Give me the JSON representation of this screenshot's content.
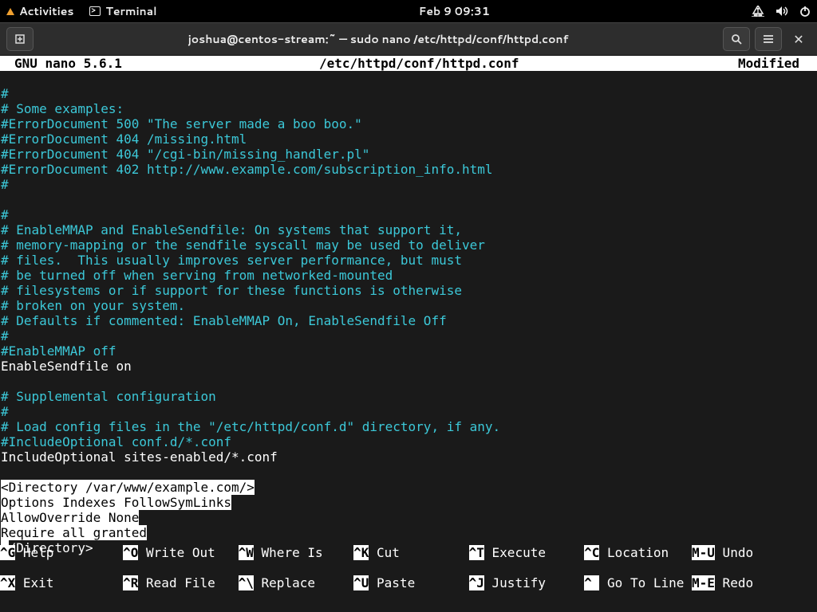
{
  "topbar": {
    "activities": "Activities",
    "terminal": "Terminal",
    "datetime": "Feb 9  09:31"
  },
  "titlebar": {
    "title": "joshua@centos-stream:~ — sudo nano /etc/httpd/conf/httpd.conf"
  },
  "statusbar": {
    "app": "GNU nano 5.6.1",
    "file": "/etc/httpd/conf/httpd.conf",
    "state": "Modified"
  },
  "lines": {
    "l1": "#",
    "l2": "# Some examples:",
    "l3": "#ErrorDocument 500 \"The server made a boo boo.\"",
    "l4": "#ErrorDocument 404 /missing.html",
    "l5": "#ErrorDocument 404 \"/cgi-bin/missing_handler.pl\"",
    "l6": "#ErrorDocument 402 http://www.example.com/subscription_info.html",
    "l7": "#",
    "l8_blank": "",
    "l9": "#",
    "l10": "# EnableMMAP and EnableSendfile: On systems that support it,",
    "l11": "# memory-mapping or the sendfile syscall may be used to deliver",
    "l12": "# files.  This usually improves server performance, but must",
    "l13": "# be turned off when serving from networked-mounted",
    "l14": "# filesystems or if support for these functions is otherwise",
    "l15": "# broken on your system.",
    "l16": "# Defaults if commented: EnableMMAP On, EnableSendfile Off",
    "l17": "#",
    "l18": "#EnableMMAP off",
    "l19": "EnableSendfile on",
    "l20_blank": "",
    "l21": "# Supplemental configuration",
    "l22": "#",
    "l23": "# Load config files in the \"/etc/httpd/conf.d\" directory, if any.",
    "l24": "#IncludeOptional conf.d/*.conf",
    "l25": "IncludeOptional sites-enabled/*.conf",
    "l26_blank": "",
    "l27": "<Directory /var/www/example.com/>",
    "l28": "Options Indexes FollowSymLinks",
    "l29": "AllowOverride None",
    "l30": "Require all granted",
    "l31a": "<",
    "l31b": "/Directory>"
  },
  "shortcuts": {
    "r1": [
      {
        "k": "^G",
        "d": " Help      "
      },
      {
        "k": "^O",
        "d": " Write Out "
      },
      {
        "k": "^W",
        "d": " Where Is  "
      },
      {
        "k": "^K",
        "d": " Cut       "
      },
      {
        "k": "^T",
        "d": " Execute   "
      },
      {
        "k": "^C",
        "d": " Location  "
      },
      {
        "k": "M-U",
        "d": " Undo"
      }
    ],
    "r2": [
      {
        "k": "^X",
        "d": " Exit      "
      },
      {
        "k": "^R",
        "d": " Read File "
      },
      {
        "k": "^\\",
        "d": " Replace   "
      },
      {
        "k": "^U",
        "d": " Paste     "
      },
      {
        "k": "^J",
        "d": " Justify   "
      },
      {
        "k": "^ ",
        "d": " Go To Line"
      },
      {
        "k": "M-E",
        "d": " Redo"
      }
    ]
  }
}
